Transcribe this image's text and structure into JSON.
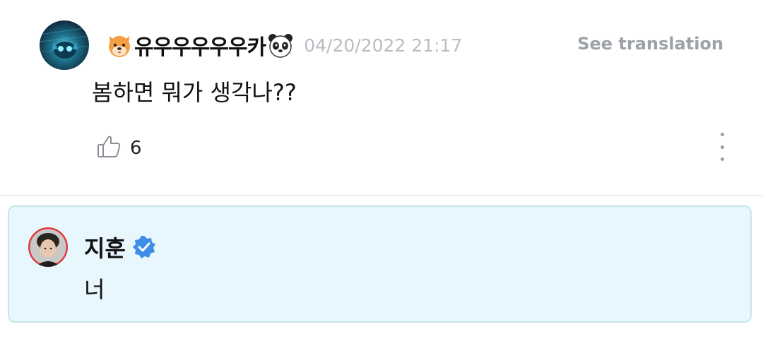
{
  "comment": {
    "username": "유우우우우우카",
    "timestamp": "04/20/2022 21:17",
    "translate_label": "See translation",
    "text": "봄하면 뭐가 생각나??",
    "like_count": "6",
    "icons": [
      "dog-emoji-icon",
      "panda-emoji-icon",
      "thumbs-up-icon",
      "more-vertical-icon"
    ]
  },
  "reply": {
    "name": "지훈",
    "text": "너",
    "icons": [
      "verified-badge-icon"
    ],
    "verified_color": "#3e8de8",
    "background": "#e8f6fd"
  }
}
